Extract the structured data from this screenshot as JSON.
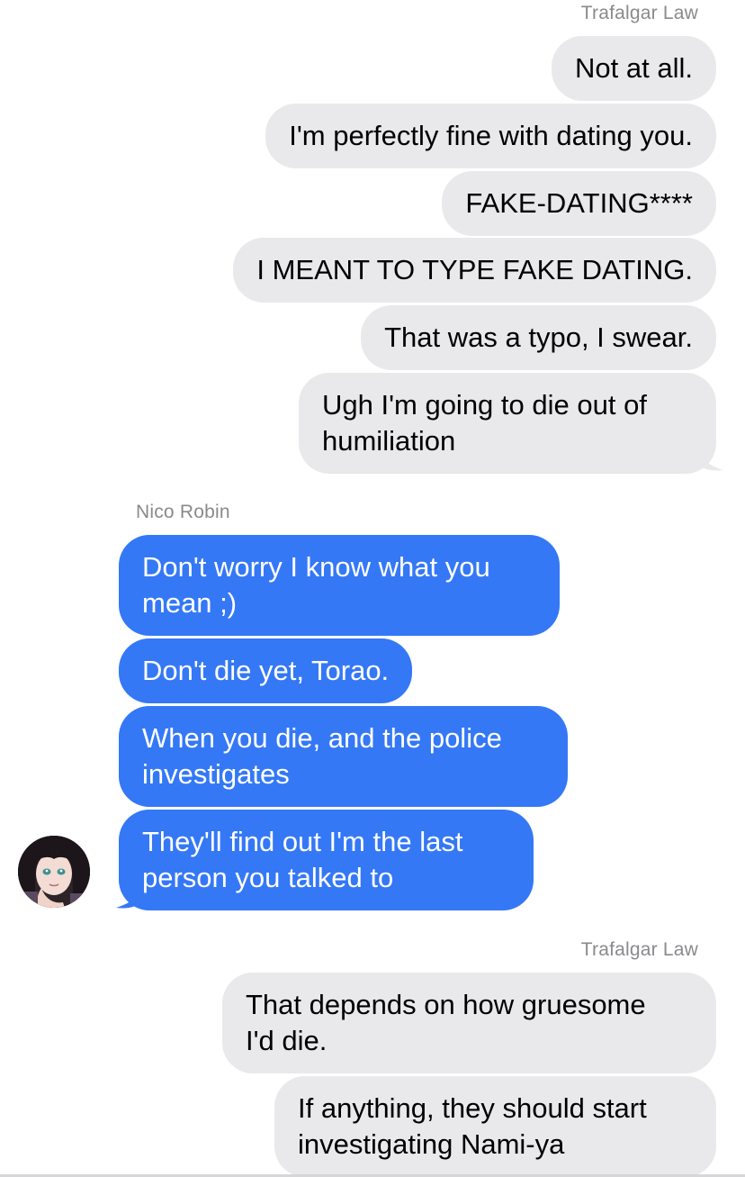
{
  "contacts": {
    "law": "Trafalgar Law",
    "robin": "Nico Robin"
  },
  "colors": {
    "outgoing_bubble": "#e9e9eb",
    "incoming_bubble": "#3478f6",
    "name_label": "#8a8a8e"
  },
  "thread": {
    "group1": [
      "Not at all.",
      "I'm perfectly fine with dating you.",
      "FAKE-DATING****",
      "I MEANT TO TYPE FAKE DATING.",
      "That was a typo, I swear.",
      [
        "Ugh I'm going to die out of",
        "humiliation"
      ]
    ],
    "group2": [
      [
        "Don't worry I know what you",
        "mean ;)"
      ],
      "Don't die yet, Torao.",
      [
        "When you die, and the police",
        "investigates"
      ],
      [
        "They'll find out I'm the last",
        "person you talked to"
      ]
    ],
    "group3": [
      [
        "That depends on how gruesome",
        "I'd die."
      ],
      [
        "If anything, they should start",
        "investigating Nami-ya"
      ]
    ]
  },
  "avatar_icon": "anime-portrait-avatar-icon"
}
